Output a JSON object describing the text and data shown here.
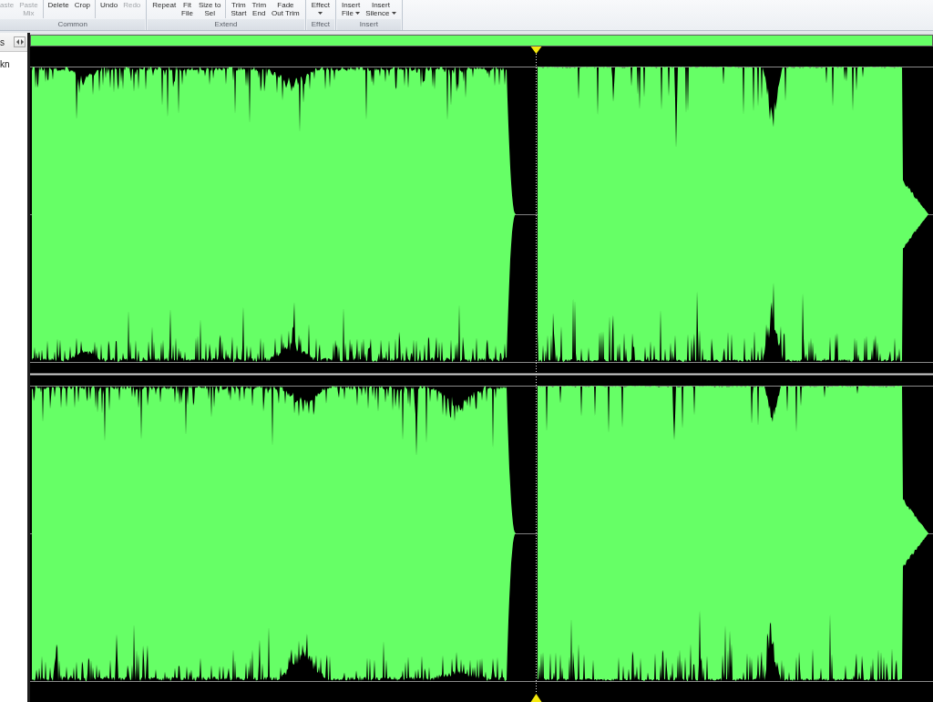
{
  "ribbon": {
    "groups": [
      {
        "label": "Common",
        "sections": [
          {
            "buttons": [
              {
                "lines": [
                  "aste"
                ],
                "disabled": true,
                "dropdown": false
              },
              {
                "lines": [
                  "Paste",
                  "Mix"
                ],
                "disabled": true,
                "dropdown": false
              }
            ]
          },
          {
            "buttons": [
              {
                "lines": [
                  "Delete"
                ],
                "disabled": false,
                "dropdown": false
              },
              {
                "lines": [
                  "Crop"
                ],
                "disabled": false,
                "dropdown": false
              }
            ]
          },
          {
            "buttons": [
              {
                "lines": [
                  "Undo"
                ],
                "disabled": false,
                "dropdown": false
              },
              {
                "lines": [
                  "Redo"
                ],
                "disabled": true,
                "dropdown": false
              }
            ]
          }
        ]
      },
      {
        "label": "Extend",
        "sections": [
          {
            "buttons": [
              {
                "lines": [
                  "Repeat"
                ],
                "disabled": false,
                "dropdown": false
              },
              {
                "lines": [
                  "Fit",
                  "File"
                ],
                "disabled": false,
                "dropdown": false
              },
              {
                "lines": [
                  "Size to",
                  "Sel"
                ],
                "disabled": false,
                "dropdown": false
              }
            ]
          },
          {
            "buttons": [
              {
                "lines": [
                  "Trim",
                  "Start"
                ],
                "disabled": false,
                "dropdown": false
              },
              {
                "lines": [
                  "Trim",
                  "End"
                ],
                "disabled": false,
                "dropdown": false
              },
              {
                "lines": [
                  "Fade",
                  "Out Trim"
                ],
                "disabled": false,
                "dropdown": false
              }
            ]
          }
        ]
      },
      {
        "label": "Effect",
        "sections": [
          {
            "buttons": [
              {
                "lines": [
                  "Effect"
                ],
                "disabled": false,
                "dropdown": true
              }
            ]
          }
        ]
      },
      {
        "label": "Insert",
        "sections": [
          {
            "buttons": [
              {
                "lines": [
                  "Insert",
                  "File"
                ],
                "disabled": false,
                "dropdown": true
              },
              {
                "lines": [
                  "Insert",
                  "Silence"
                ],
                "disabled": false,
                "dropdown": true
              }
            ]
          }
        ]
      }
    ]
  },
  "side_panel": {
    "title": "s",
    "items": [
      {
        "label": "kn"
      }
    ]
  }
}
